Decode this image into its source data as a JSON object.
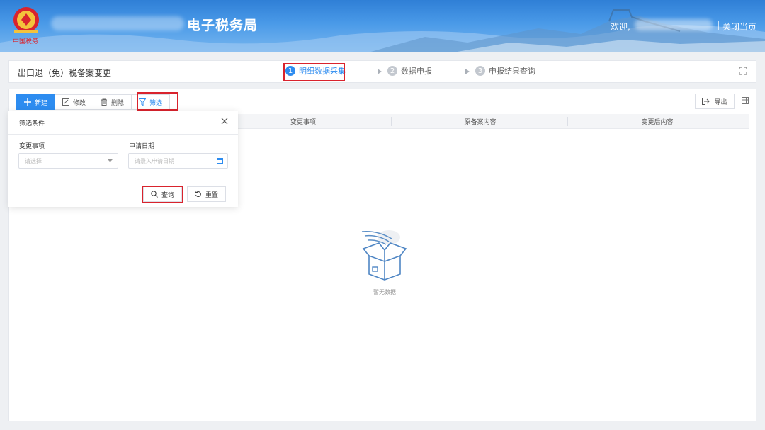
{
  "header": {
    "site_title": "电子税务局",
    "welcome": "欢迎,",
    "close_page": "关闭当页"
  },
  "page": {
    "title": "出口退（免）税备案变更"
  },
  "steps": [
    {
      "num": "1",
      "label": "明细数据采集",
      "active": true
    },
    {
      "num": "2",
      "label": "数据申报",
      "active": false
    },
    {
      "num": "3",
      "label": "申报结果查询",
      "active": false
    }
  ],
  "toolbar": {
    "new": "新建",
    "edit": "修改",
    "delete": "删除",
    "filter": "筛选",
    "export": "导出"
  },
  "table": {
    "columns": [
      "变更事项",
      "原备案内容",
      "变更后内容"
    ],
    "empty_text": "暂无数据"
  },
  "filter_panel": {
    "title": "筛选条件",
    "field1_label": "变更事项",
    "field1_placeholder": "请选择",
    "field2_label": "申请日期",
    "field2_placeholder": "请录入申请日期",
    "query": "查询",
    "reset": "重置"
  },
  "colors": {
    "primary": "#2d8cf0",
    "highlight": "#d9232d",
    "header_blue": "#3a88dc"
  }
}
